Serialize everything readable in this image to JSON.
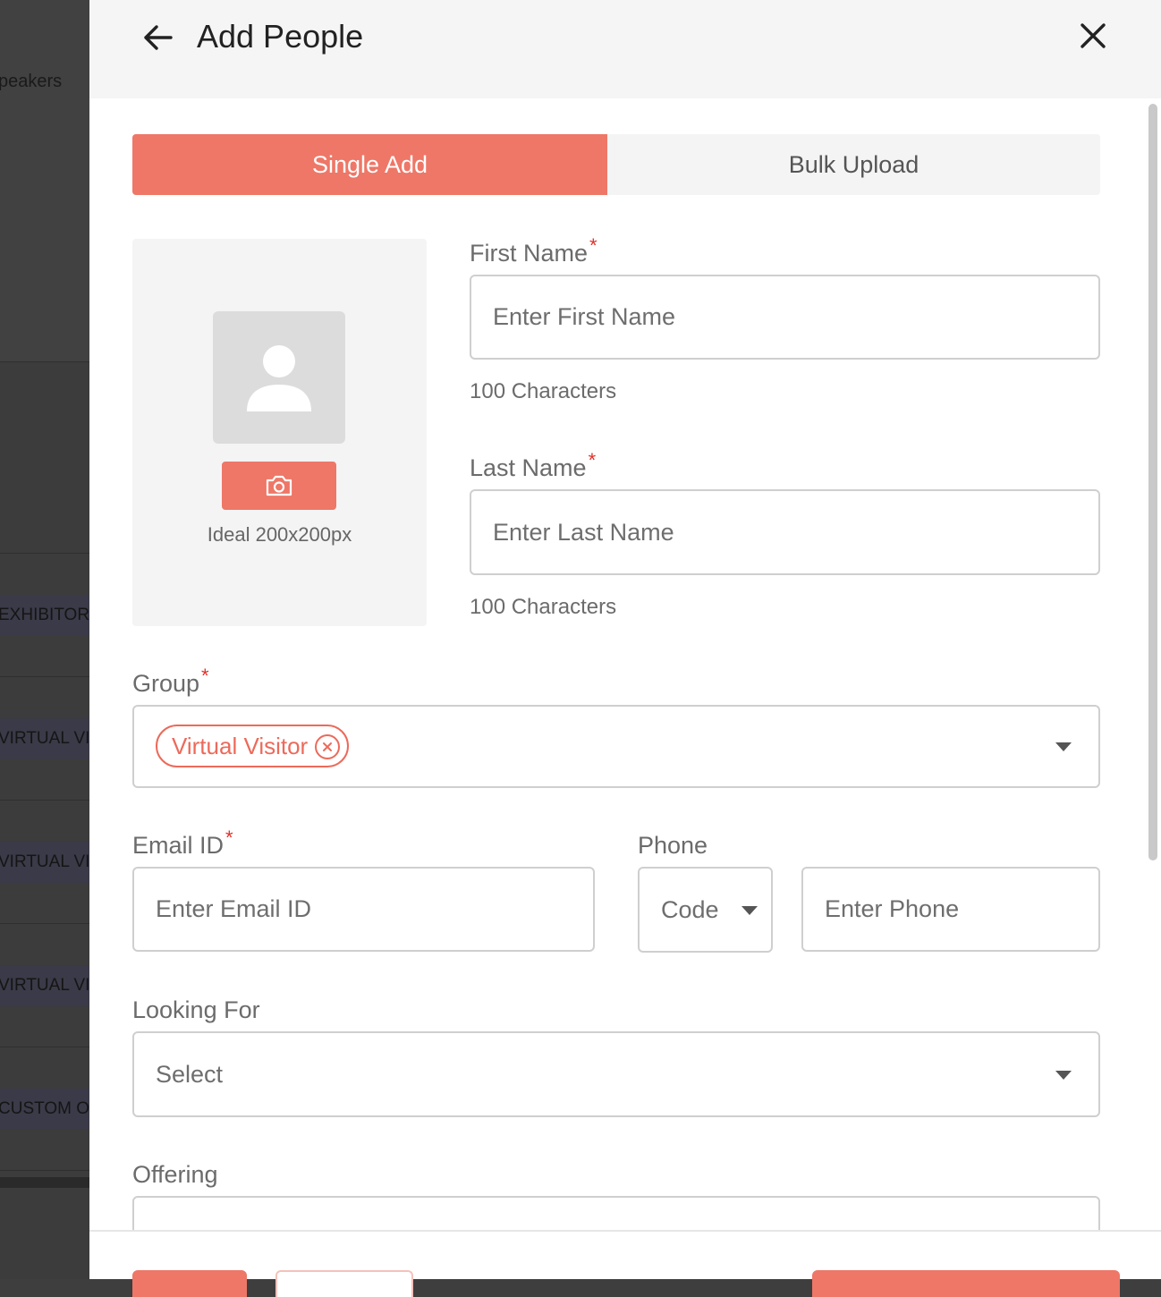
{
  "background": {
    "items": [
      "peakers",
      "EXHIBITOR",
      "VIRTUAL VI",
      "VIRTUAL VI",
      "VIRTUAL VI",
      "CUSTOM O"
    ]
  },
  "header": {
    "title": "Add People",
    "back_icon": "arrow-left-icon",
    "close_icon": "close-icon"
  },
  "tabs": [
    {
      "label": "Single Add",
      "active": true
    },
    {
      "label": "Bulk Upload",
      "active": false
    }
  ],
  "photo": {
    "hint": "Ideal 200x200px",
    "camera_icon": "camera-icon",
    "placeholder_icon": "user-silhouette-icon"
  },
  "first_name": {
    "label": "First Name",
    "required": "*",
    "placeholder": "Enter First Name",
    "hint": "100 Characters"
  },
  "last_name": {
    "label": "Last Name",
    "required": "*",
    "placeholder": "Enter Last Name",
    "hint": "100 Characters"
  },
  "group": {
    "label": "Group",
    "required": "*",
    "chips": [
      "Virtual Visitor"
    ]
  },
  "email": {
    "label": "Email ID",
    "required": "*",
    "placeholder": "Enter Email ID"
  },
  "phone": {
    "label": "Phone",
    "code_value": "Code",
    "placeholder": "Enter Phone"
  },
  "looking_for": {
    "label": "Looking For",
    "value": "Select"
  },
  "offering": {
    "label": "Offering"
  },
  "colors": {
    "accent": "#ee7767",
    "required": "#e0312a"
  }
}
